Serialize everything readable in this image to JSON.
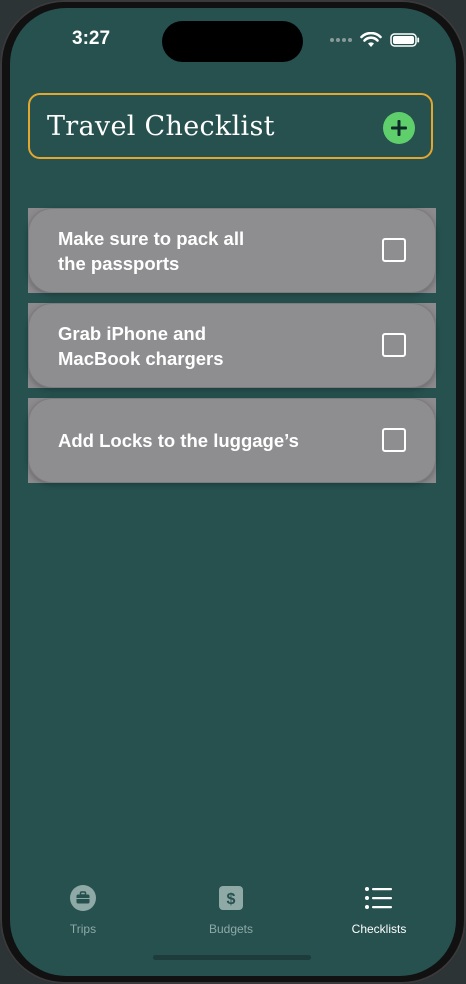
{
  "status_bar": {
    "time": "3:27"
  },
  "header": {
    "title": "Travel Checklist",
    "add_icon": "plus-circle-icon"
  },
  "checklist": [
    {
      "text": "Make sure to pack all\nthe passports",
      "checked": false
    },
    {
      "text": "Grab iPhone and\nMacBook chargers",
      "checked": false
    },
    {
      "text": "Add Locks to the luggage’s",
      "checked": false
    }
  ],
  "tabs": [
    {
      "label": "Trips",
      "icon": "briefcase-icon",
      "active": false
    },
    {
      "label": "Budgets",
      "icon": "dollar-icon",
      "active": false
    },
    {
      "label": "Checklists",
      "icon": "list-icon",
      "active": true
    }
  ],
  "colors": {
    "background": "#26514f",
    "accent_border": "#e3a72f",
    "add_button": "#5fcf6b",
    "card": "#8e8d90"
  }
}
